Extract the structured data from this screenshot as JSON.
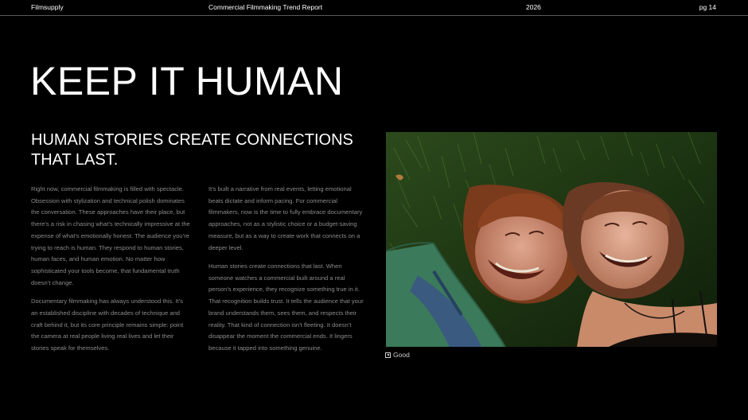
{
  "header": {
    "brand": "Filmsupply",
    "report_title": "Commercial Filmmaking Trend Report",
    "year": "2026",
    "page": "pg 14"
  },
  "main": {
    "title": "KEEP IT HUMAN",
    "subtitle": "HUMAN STORIES CREATE CONNECTIONS THAT LAST.",
    "column_1": [
      "Right now, commercial filmmaking is filled with spectacle. Obsession with stylization and technical polish dominates the conversation. These approaches have their place, but there’s a risk in chasing what’s technically impressive at the expense of what’s emotionally honest. The audience you’re trying to reach is human. They respond to human stories, human faces, and human emotion. No matter how sophisticated your tools become, that fundamental truth doesn’t change.",
      "Documentary filmmaking has always understood this. It’s an established discipline with decades of technique and craft behind it, but its core principle remains simple: point the camera at real people living real lives and let their stories speak for themselves."
    ],
    "column_2": [
      "It’s built a narrative from real events, letting emotional beats dictate and inform pacing. For commercial filmmakers, now is the time to fully embrace documentary approaches, not as a stylistic choice or a budget-saving measure, but as a way to create work that connects on a deeper level.",
      "Human stories create connections that last. When someone watches a commercial built around a real person’s experience, they recognize something true in it. That recognition builds trust. It tells the audience that your brand understands them, sees them, and respects their reality. That kind of connection isn’t fleeting. It doesn’t disappear the moment the commercial ends. It lingers because it tapped into something genuine."
    ],
    "image_caption": "Good",
    "caption_icon": "square-icon"
  },
  "colors": {
    "background": "#000000",
    "text": "#ffffff",
    "body_text": "#8a8a8a",
    "rule": "#5a5a5a"
  }
}
